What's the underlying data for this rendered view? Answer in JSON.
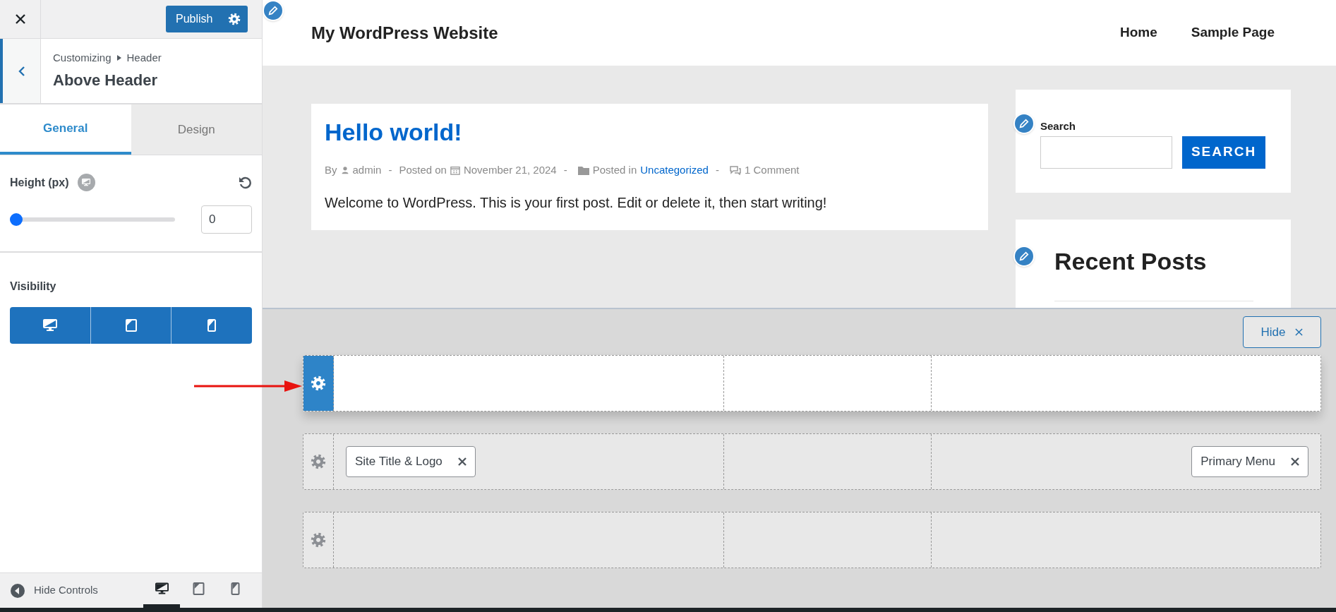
{
  "topbar": {
    "publish": "Publish"
  },
  "section": {
    "breadcrumb": [
      "Customizing",
      "Header"
    ],
    "title": "Above Header"
  },
  "tabs": [
    {
      "label": "General",
      "selected": true
    },
    {
      "label": "Design",
      "selected": false
    }
  ],
  "height_control": {
    "label": "Height (px)",
    "level": 0,
    "value": "0"
  },
  "visibility": {
    "label": "Visibility",
    "devices": [
      {
        "kind": "desktop",
        "selected": true
      },
      {
        "kind": "tablet",
        "selected": true
      },
      {
        "kind": "mobile",
        "selected": true
      }
    ]
  },
  "footer": {
    "hide_controls": "Hide Controls",
    "devices": [
      {
        "kind": "desktop",
        "selected": true
      },
      {
        "kind": "tablet",
        "selected": false
      },
      {
        "kind": "mobile",
        "selected": false
      }
    ]
  },
  "site": {
    "title": "My WordPress Website",
    "nav": [
      "Home",
      "Sample Page"
    ]
  },
  "post": {
    "title": "Hello world!",
    "meta": {
      "by": "By",
      "author": "admin",
      "posted_on": "Posted on",
      "date": "November 21, 2024",
      "posted_in": "Posted in",
      "category": "Uncategorized",
      "comments": "1 Comment",
      "separators": [
        "-",
        "-",
        "-"
      ]
    },
    "excerpt": "Welcome to WordPress. This is your first post. Edit or delete it, then start writing!"
  },
  "sidebar": {
    "search_label": "Search",
    "search_button": "SEARCH",
    "recent_title": "Recent Posts"
  },
  "builder": {
    "hide": "Hide",
    "rows": [
      {
        "active": true
      },
      {
        "active": false,
        "left": [
          {
            "label": "Site Title & Logo"
          }
        ],
        "right": [
          {
            "label": "Primary Menu"
          }
        ]
      },
      {
        "active": false
      }
    ]
  }
}
